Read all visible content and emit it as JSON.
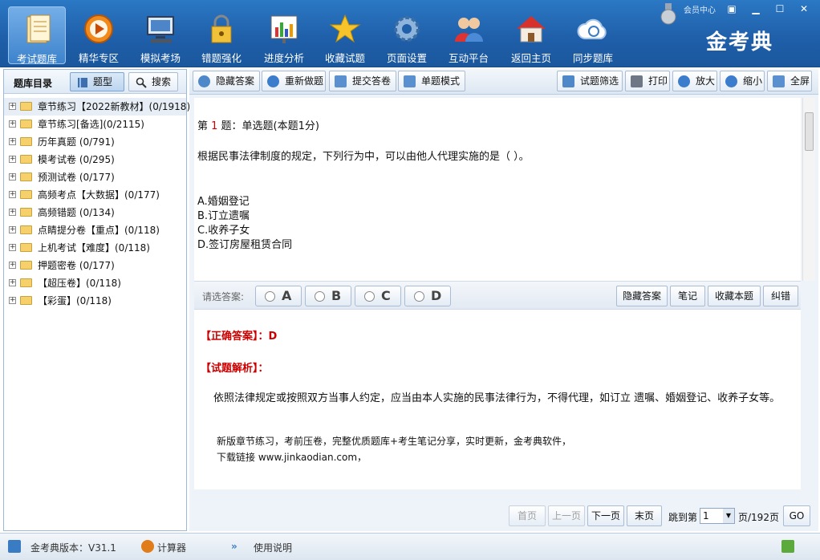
{
  "topbar": {
    "items": [
      {
        "label": "考试题库",
        "icon": "question-bank-icon",
        "active": true
      },
      {
        "label": "精华专区",
        "icon": "play-icon"
      },
      {
        "label": "模拟考场",
        "icon": "monitor-icon"
      },
      {
        "label": "错题强化",
        "icon": "lock-icon"
      },
      {
        "label": "进度分析",
        "icon": "chart-icon"
      },
      {
        "label": "收藏试题",
        "icon": "star-icon"
      },
      {
        "label": "页面设置",
        "icon": "gear-icon"
      },
      {
        "label": "互动平台",
        "icon": "users-icon"
      },
      {
        "label": "返回主页",
        "icon": "home-icon"
      },
      {
        "label": "同步题库",
        "icon": "cloud-sync-icon"
      }
    ],
    "member": "会员中心",
    "logo": "金考典"
  },
  "left": {
    "title": "题库目录",
    "type_btn": "题型",
    "search_btn": "搜索",
    "tree": [
      "章节练习【2022新教材】(0/1918)",
      "章节练习[备选](0/2115)",
      "历年真题 (0/791)",
      "模考试卷 (0/295)",
      "预测试卷 (0/177)",
      "高频考点【大数据】(0/177)",
      "高频错题 (0/134)",
      "点睛提分卷【重点】(0/118)",
      "上机考试【难度】(0/118)",
      "押题密卷 (0/177)",
      "【超压卷】(0/118)",
      "【彩蛋】(0/118)"
    ]
  },
  "toolbar": {
    "hide_answer": "隐藏答案",
    "redo": "重新做题",
    "submit": "提交答卷",
    "single_mode": "单题模式",
    "filter": "试题筛选",
    "print": "打印",
    "zoom_in": "放大",
    "zoom_out": "缩小",
    "fullscreen": "全屏"
  },
  "question": {
    "prefix": "第 ",
    "number": "1",
    "suffix": " 题：单选题(本题1分)",
    "text": "根据民事法律制度的规定，下列行为中，可以由他人代理实施的是（  ）。",
    "options": [
      "A.婚姻登记",
      "B.订立遗嘱",
      "C.收养子女",
      "D.签订房屋租赁合同"
    ]
  },
  "answer_bar": {
    "label": "请选答案:",
    "choices": [
      "A",
      "B",
      "C",
      "D"
    ],
    "hide_answer": "隐藏答案",
    "note": "笔记",
    "favorite": "收藏本题",
    "correct": "纠错"
  },
  "explain": {
    "correct_label": "【正确答案】：",
    "correct_value": "D",
    "analysis_label": "【试题解析】：",
    "analysis_text": "依照法律规定或按照双方当事人约定，应当由本人实施的民事法律行为，不得代理，如订立 遗嘱、婚姻登记、收养子女等。",
    "ad_line1": "新版章节练习，考前压卷，完整优质题库+考生笔记分享，实时更新，金考典软件，",
    "ad_line2": "下载链接 www.jinkaodian.com，"
  },
  "pager": {
    "first": "首页",
    "prev": "上一页",
    "next": "下一页",
    "last": "末页",
    "jump_label": "跳到第",
    "page_value": "1",
    "total": "页/192页",
    "go": "GO"
  },
  "status": {
    "version": "金考典版本：V31.1",
    "calculator": "计算器",
    "manual": "使用说明"
  }
}
